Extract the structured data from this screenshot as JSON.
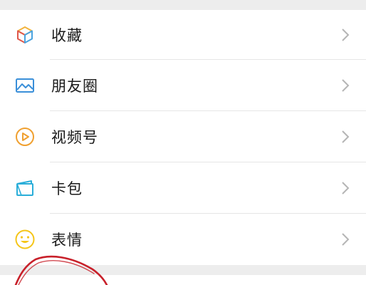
{
  "menu": {
    "items": [
      {
        "label": "收藏",
        "icon": "favorites-cube-icon"
      },
      {
        "label": "朋友圈",
        "icon": "moments-image-icon"
      },
      {
        "label": "视频号",
        "icon": "channels-play-icon"
      },
      {
        "label": "卡包",
        "icon": "cards-wallet-icon"
      },
      {
        "label": "表情",
        "icon": "stickers-smiley-icon"
      }
    ]
  },
  "colors": {
    "favorites_icon": [
      "#f2b33d",
      "#e0584b",
      "#4aa3df"
    ],
    "moments_icon": "#3a8fd9",
    "channels_icon": "#f0a030",
    "cards_icon": "#2aaed9",
    "stickers_icon": "#f5c518",
    "annotation": "#c8202a"
  }
}
